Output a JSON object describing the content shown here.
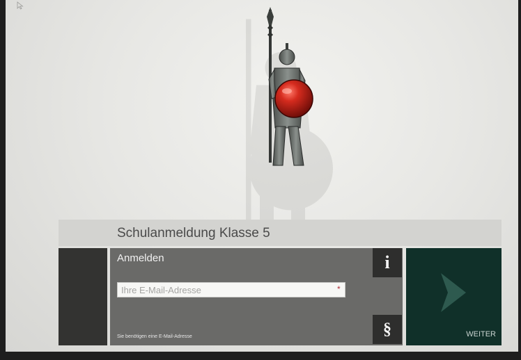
{
  "page": {
    "title": "Schulanmeldung Klasse 5"
  },
  "mascot": {
    "icon": "knight-with-shield-icon",
    "shield_color": "#d0271d"
  },
  "login": {
    "heading": "Anmelden",
    "email_placeholder": "Ihre E-Mail-Adresse",
    "email_value": "",
    "required_mark": "*",
    "hint": "Sie benötigen eine E-Mail-Adresse",
    "info_label": "i",
    "legal_label": "§"
  },
  "next": {
    "label": "WEITER",
    "icon": "chevron-right-icon",
    "accent": "#103029"
  }
}
